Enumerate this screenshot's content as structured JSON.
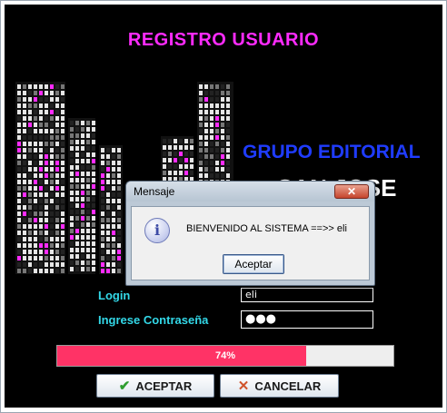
{
  "form": {
    "title": "REGISTRO USUARIO",
    "brand_line1": "GRUPO EDITORIAL",
    "brand_line2": "SAN JOSE",
    "login_label": "Login",
    "login_value": "eli",
    "password_label": "Ingrese Contraseña",
    "password_value": "●●●",
    "progress": {
      "percent": 74,
      "label": "74%",
      "color": "#ff3366"
    },
    "accept_button": {
      "label": "ACEPTAR",
      "icon": "checkmark-icon"
    },
    "cancel_button": {
      "label": "CANCELAR",
      "icon": "x-icon"
    }
  },
  "dialog": {
    "title": "Mensaje",
    "close_icon": "close-icon",
    "icon": "info-icon",
    "message": "BIENVENIDO AL SISTEMA ==>> eli",
    "ok_label": "Aceptar"
  },
  "colors": {
    "background": "#000000",
    "title": "#ff2bff",
    "brand_line1": "#1f3cff",
    "labels": "#33d8e8",
    "progress_fill": "#ff3366"
  }
}
